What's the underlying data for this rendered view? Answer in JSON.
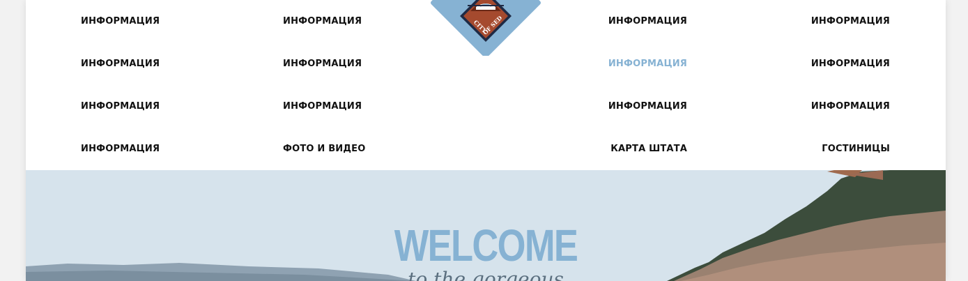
{
  "nav": {
    "items": [
      {
        "label": "ИНФОРМАЦИЯ"
      },
      {
        "label": "ИНФОРМАЦИЯ"
      },
      {
        "label": "ИНФОРМАЦИЯ"
      },
      {
        "label": "ИНФОРМАЦИЯ"
      },
      {
        "label": "ИНФОРМАЦИЯ"
      },
      {
        "label": "ИНФОРМАЦИЯ"
      },
      {
        "label": "ИНФОРМАЦИЯ",
        "active": true
      },
      {
        "label": "ИНФОРМАЦИЯ"
      },
      {
        "label": "ИНФОРМАЦИЯ"
      },
      {
        "label": "ИНФОРМАЦИЯ"
      },
      {
        "label": "ИНФОРМАЦИЯ"
      },
      {
        "label": "ИНФОРМАЦИЯ"
      },
      {
        "label": "ИНФОРМАЦИЯ"
      },
      {
        "label": "ФОТО И ВИДЕО"
      },
      {
        "label": "КАРТА ШТАТА"
      },
      {
        "label": "ГОСТИНИЦЫ"
      }
    ]
  },
  "logo": {
    "text": "CITY OF SEDONA"
  },
  "hero": {
    "title": "WELCOME",
    "subtitle": "to the gorgeous"
  },
  "colors": {
    "accent": "#86b2d3",
    "text": "#111111",
    "logo_red": "#a54a2e",
    "logo_navy": "#1f2a44"
  }
}
